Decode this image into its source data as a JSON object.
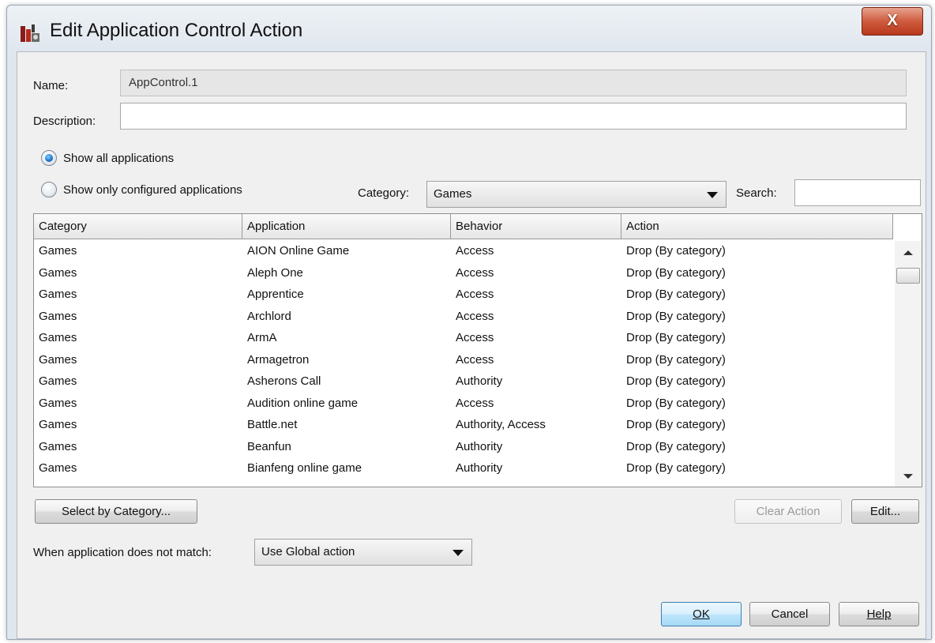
{
  "window": {
    "title": "Edit Application Control Action",
    "close_label": "X"
  },
  "form": {
    "name_label": "Name:",
    "name_value": "AppControl.1",
    "description_label": "Description:",
    "description_value": ""
  },
  "filter": {
    "show_all_label": "Show all applications",
    "show_configured_label": "Show only configured applications",
    "selected": "show_all",
    "category_label": "Category:",
    "category_value": "Games",
    "search_label": "Search:",
    "search_value": ""
  },
  "table": {
    "columns": [
      "Category",
      "Application",
      "Behavior",
      "Action"
    ],
    "rows": [
      [
        "Games",
        "AION Online Game",
        "Access",
        "Drop (By category)"
      ],
      [
        "Games",
        "Aleph One",
        "Access",
        "Drop (By category)"
      ],
      [
        "Games",
        "Apprentice",
        "Access",
        "Drop (By category)"
      ],
      [
        "Games",
        "Archlord",
        "Access",
        "Drop (By category)"
      ],
      [
        "Games",
        "ArmA",
        "Access",
        "Drop (By category)"
      ],
      [
        "Games",
        "Armagetron",
        "Access",
        "Drop (By category)"
      ],
      [
        "Games",
        "Asherons Call",
        "Authority",
        "Drop (By category)"
      ],
      [
        "Games",
        "Audition online game",
        "Access",
        "Drop (By category)"
      ],
      [
        "Games",
        "Battle.net",
        "Authority, Access",
        "Drop (By category)"
      ],
      [
        "Games",
        "Beanfun",
        "Authority",
        "Drop (By category)"
      ],
      [
        "Games",
        "Bianfeng online game",
        "Authority",
        "Drop (By category)"
      ]
    ]
  },
  "actions": {
    "select_by_category": "Select by Category...",
    "clear_action": "Clear Action",
    "edit": "Edit..."
  },
  "nomatch": {
    "label": "When application does not match:",
    "value": "Use Global action"
  },
  "footer": {
    "ok": "OK",
    "cancel": "Cancel",
    "help": "Help"
  }
}
